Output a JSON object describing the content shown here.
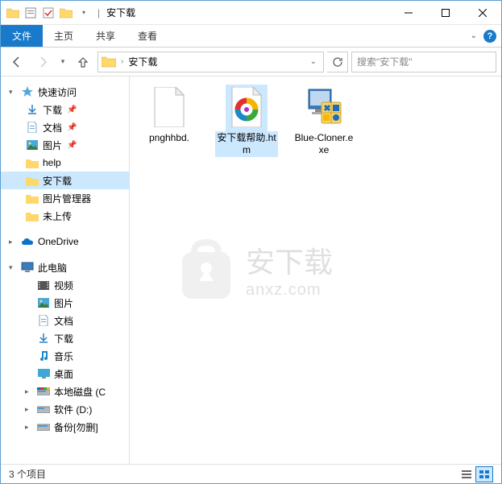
{
  "window": {
    "title": "安下载"
  },
  "ribbon": {
    "file": "文件",
    "home": "主页",
    "share": "共享",
    "view": "查看"
  },
  "address": {
    "path": "安下载"
  },
  "search": {
    "placeholder": "搜索\"安下载\""
  },
  "nav": {
    "quick_access": "快速访问",
    "downloads": "下载",
    "documents": "文档",
    "pictures": "图片",
    "help": "help",
    "anxz": "安下载",
    "pic_manager": "图片管理器",
    "not_uploaded": "未上传",
    "onedrive": "OneDrive",
    "this_pc": "此电脑",
    "videos": "视频",
    "pictures2": "图片",
    "documents2": "文档",
    "downloads2": "下载",
    "music": "音乐",
    "desktop": "桌面",
    "local_c": "本地磁盘 (C",
    "soft_d": "软件 (D:)",
    "backup": "备份[勿删]"
  },
  "files": [
    {
      "name": "pnghhbd."
    },
    {
      "name": "安下载帮助.htm"
    },
    {
      "name": "Blue-Cloner.exe"
    }
  ],
  "status": {
    "count": "3 个项目"
  },
  "watermark": {
    "cn": "安下载",
    "en": "anxz.com"
  }
}
